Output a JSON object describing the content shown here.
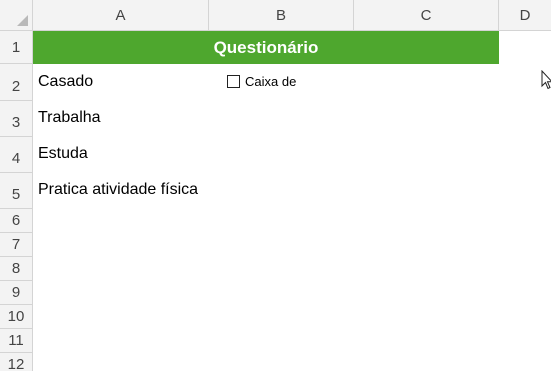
{
  "columns": [
    "A",
    "B",
    "C",
    "D"
  ],
  "rows": [
    "1",
    "2",
    "3",
    "4",
    "5",
    "6",
    "7",
    "8",
    "9",
    "10",
    "11",
    "12"
  ],
  "title_band": {
    "text": "Questionário",
    "color": "#4ea72e"
  },
  "cells": {
    "a2": "Casado",
    "a3": "Trabalha",
    "a4": "Estuda",
    "a5": "Pratica atividade física"
  },
  "checkbox": {
    "label": "Caixa de",
    "checked": false
  },
  "icons": {
    "cursor": "mouse-pointer-icon",
    "corner": "select-all-triangle-icon"
  }
}
